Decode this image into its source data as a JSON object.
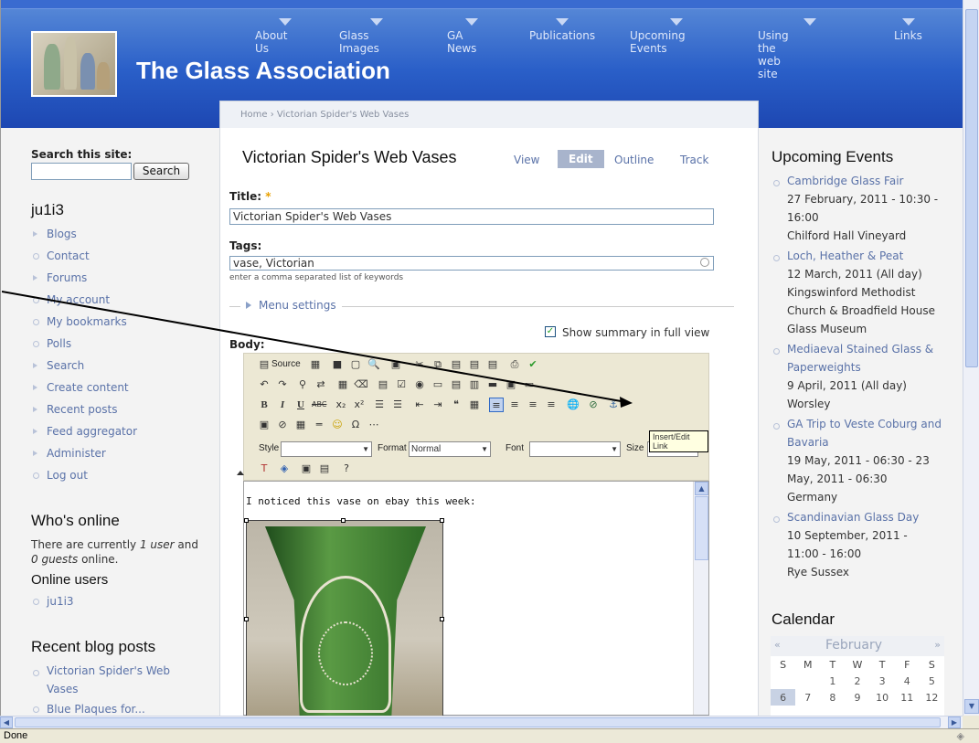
{
  "site": {
    "name": "The Glass Association"
  },
  "nav": [
    "About Us",
    "Glass Images",
    "GA News",
    "Publications",
    "Upcoming Events",
    "Using the web site",
    "Links"
  ],
  "breadcrumb": "Home › Victorian Spider's Web Vases",
  "search": {
    "label": "Search this site:",
    "button": "Search",
    "value": ""
  },
  "user": {
    "name": "ju1i3",
    "menu": [
      "Blogs",
      "Contact",
      "Forums",
      "My account",
      "My bookmarks",
      "Polls",
      "Search",
      "Create content",
      "Recent posts",
      "Feed aggregator",
      "Administer",
      "Log out"
    ]
  },
  "whos_online": {
    "title": "Who's online",
    "text_a": "There are currently ",
    "text_users": "1 user",
    "text_b": " and",
    "text_guests": "0 guests",
    "text_c": " online.",
    "online_users_label": "Online users",
    "online_user": "ju1i3"
  },
  "recent_blog": {
    "title": "Recent blog posts",
    "items": [
      "Victorian Spider's Web Vases",
      "Blue Plaques for..."
    ]
  },
  "node": {
    "title": "Victorian Spider's Web Vases",
    "tabs": [
      "View",
      "Edit",
      "Outline",
      "Track"
    ],
    "title_label": "Title:",
    "required": "*",
    "title_value": "Victorian Spider's Web Vases",
    "tags_label": "Tags:",
    "tags_value": "vase, Victorian",
    "tags_help": "enter a comma separated list of keywords",
    "menu_settings": "Menu settings",
    "summary_label": "Show summary in full view",
    "body_label": "Body:",
    "body_text": "I noticed this vase on ebay this week:"
  },
  "editor": {
    "source": "Source",
    "style_label": "Style",
    "format_label": "Format",
    "format_value": "Normal",
    "font_label": "Font",
    "size_label": "Size",
    "tooltip": "Insert/Edit Link"
  },
  "upcoming": {
    "title": "Upcoming Events",
    "events": [
      {
        "name": "Cambridge Glass Fair",
        "lines": [
          "27 February, 2011 - 10:30 -",
          "16:00",
          "Chilford Hall Vineyard"
        ]
      },
      {
        "name": "Loch, Heather & Peat",
        "lines": [
          "12 March, 2011 (All day)",
          "Kingswinford Methodist",
          "Church & Broadfield House",
          "Glass Museum"
        ]
      },
      {
        "name": "Mediaeval Stained Glass & Paperweights",
        "lines": [
          "9 April, 2011 (All day)",
          "Worsley"
        ]
      },
      {
        "name": "GA Trip to Veste Coburg and Bavaria",
        "lines": [
          "19 May, 2011 - 06:30 - 23",
          "May, 2011 - 06:30",
          "Germany"
        ]
      },
      {
        "name": "Scandinavian Glass Day",
        "lines": [
          "10 September, 2011 -",
          "11:00 - 16:00",
          "Rye Sussex"
        ]
      }
    ]
  },
  "calendar": {
    "title": "Calendar",
    "prev": "«",
    "month": "February",
    "next": "»",
    "days": [
      "S",
      "M",
      "T",
      "W",
      "T",
      "F",
      "S"
    ],
    "week1": [
      "",
      "",
      "1",
      "2",
      "3",
      "4",
      "5"
    ],
    "week2": [
      "6",
      "7",
      "8",
      "9",
      "10",
      "11",
      "12"
    ]
  },
  "status": {
    "text": "Done"
  },
  "colors": {
    "header": "#2a5fc8",
    "link": "#5a72a8",
    "active_tab": "#a8b4cc"
  }
}
